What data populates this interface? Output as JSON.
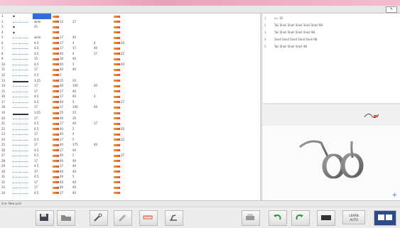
{
  "topbar": {
    "corner_button_label": "✎"
  },
  "program": {
    "rows": [
      {
        "idx": "1",
        "icon": "feed-icon",
        "c1": "",
        "c2": "",
        "c3": "",
        "c4": "",
        "c5": "",
        "c6": "",
        "selected": true
      },
      {
        "idx": "2",
        "icon": "wave-small",
        "c1": "wide",
        "c2": "12",
        "c3": "17",
        "c4": "",
        "c5": "",
        "c6": ""
      },
      {
        "idx": "3",
        "icon": "tool-icon",
        "c1": "45",
        "c2": "",
        "c3": "",
        "c4": "",
        "c5": "",
        "c6": ""
      },
      {
        "idx": "4",
        "icon": "start-icon",
        "c1": "",
        "c2": "",
        "c3": "",
        "c4": "",
        "c5": "",
        "c6": ""
      },
      {
        "idx": "5",
        "icon": "wave-small",
        "c1": "wide",
        "c2": "17",
        "c3": "40",
        "c4": "",
        "c5": "",
        "c6": ""
      },
      {
        "idx": "6",
        "icon": "wave-small",
        "c1": "4.5",
        "c2": "17",
        "c3": "4",
        "c4": "4",
        "c5": "20",
        "c6": ""
      },
      {
        "idx": "7",
        "icon": "wave-small",
        "c1": "4.5",
        "c2": "17",
        "c3": "17",
        "c4": "40",
        "c5": "",
        "c6": ""
      },
      {
        "idx": "8",
        "icon": "wave-small",
        "c1": "4.5",
        "c2": "40",
        "c3": "4",
        "c4": "17",
        "c5": "22",
        "c6": ""
      },
      {
        "idx": "9",
        "icon": "wave-small",
        "c1": "15",
        "c2": "30",
        "c3": "40",
        "c4": "",
        "c5": "",
        "c6": ""
      },
      {
        "idx": "10",
        "icon": "wave-small",
        "c1": "4.5",
        "c2": "40",
        "c3": "5",
        "c4": "",
        "c5": "40",
        "c6": ""
      },
      {
        "idx": "11",
        "icon": "wave-small",
        "c1": "17",
        "c2": "40",
        "c3": "40",
        "c4": "",
        "c5": "",
        "c6": ""
      },
      {
        "idx": "12",
        "icon": "wave-small",
        "c1": "4.5",
        "c2": "5",
        "c3": "",
        "c4": "",
        "c5": "",
        "c6": ""
      },
      {
        "idx": "13",
        "icon": "wave-big",
        "c1": "3.25",
        "c2": "35",
        "c3": "25",
        "c4": "",
        "c5": "",
        "c6": ""
      },
      {
        "idx": "14",
        "icon": "wave-small",
        "c1": "17",
        "c2": "40",
        "c3": "100",
        "c4": "40",
        "c5": "",
        "c6": ""
      },
      {
        "idx": "15",
        "icon": "wave-small",
        "c1": "17",
        "c2": "17",
        "c3": "40",
        "c4": "",
        "c5": "",
        "c6": ""
      },
      {
        "idx": "16",
        "icon": "wave-small",
        "c1": "4.5",
        "c2": "17",
        "c3": "40",
        "c4": "4",
        "c5": "",
        "c6": ""
      },
      {
        "idx": "17",
        "icon": "wave-small",
        "c1": "4.5",
        "c2": "40",
        "c3": "5",
        "c4": "",
        "c5": "17",
        "c6": ""
      },
      {
        "idx": "18",
        "icon": "wave-small",
        "c1": "17",
        "c2": "17",
        "c3": "100",
        "c4": "40",
        "c5": "",
        "c6": ""
      },
      {
        "idx": "19",
        "icon": "wave-big",
        "c1": "3.25",
        "c2": "35",
        "c3": "25",
        "c4": "",
        "c5": "",
        "c6": ""
      },
      {
        "idx": "20",
        "icon": "wave-small",
        "c1": "17",
        "c2": "40",
        "c3": "30",
        "c4": "",
        "c5": "",
        "c6": ""
      },
      {
        "idx": "21",
        "icon": "wave-small",
        "c1": "4.5",
        "c2": "17",
        "c3": "40",
        "c4": "17",
        "c5": "",
        "c6": ""
      },
      {
        "idx": "22",
        "icon": "wave-small",
        "c1": "4.5",
        "c2": "40",
        "c3": "5",
        "c4": "",
        "c5": "20",
        "c6": ""
      },
      {
        "idx": "23",
        "icon": "wave-small",
        "c1": "17",
        "c2": "40",
        "c3": "4",
        "c4": "",
        "c5": "",
        "c6": ""
      },
      {
        "idx": "24",
        "icon": "wave-small",
        "c1": "4.5",
        "c2": "17",
        "c3": "5",
        "c4": "",
        "c5": "22",
        "c6": ""
      },
      {
        "idx": "25",
        "icon": "wave-small",
        "c1": "17",
        "c2": "40",
        "c3": "175",
        "c4": "40",
        "c5": "",
        "c6": ""
      },
      {
        "idx": "26",
        "icon": "wave-small",
        "c1": "4.5",
        "c2": "17",
        "c3": "40",
        "c4": "",
        "c5": "",
        "c6": ""
      },
      {
        "idx": "27",
        "icon": "wave-small",
        "c1": "4.5",
        "c2": "40",
        "c3": "5",
        "c4": "",
        "c5": "17",
        "c6": ""
      },
      {
        "idx": "28",
        "icon": "wave-small",
        "c1": "17",
        "c2": "40",
        "c3": "40",
        "c4": "",
        "c5": "",
        "c6": ""
      },
      {
        "idx": "29",
        "icon": "wave-small",
        "c1": "4.5",
        "c2": "17",
        "c3": "40",
        "c4": "",
        "c5": "",
        "c6": ""
      },
      {
        "idx": "30",
        "icon": "wave-small",
        "c1": "17",
        "c2": "40",
        "c3": "40",
        "c4": "",
        "c5": "",
        "c6": ""
      },
      {
        "idx": "31",
        "icon": "wave-small",
        "c1": "4.5",
        "c2": "40",
        "c3": "5",
        "c4": "",
        "c5": "",
        "c6": ""
      },
      {
        "idx": "32",
        "icon": "wave-small",
        "c1": "17",
        "c2": "40",
        "c3": "40",
        "c4": "",
        "c5": "",
        "c6": ""
      },
      {
        "idx": "33",
        "icon": "wave-small",
        "c1": "17",
        "c2": "40",
        "c3": "40",
        "c4": "",
        "c5": "",
        "c6": ""
      },
      {
        "idx": "34",
        "icon": "wave-small",
        "c1": "4.5",
        "c2": "17",
        "c3": "40",
        "c4": "",
        "c5": "",
        "c6": ""
      }
    ]
  },
  "right_panel": {
    "lines": [
      {
        "n": "1",
        "text": "x= 16"
      },
      {
        "n": "2",
        "text": "Tail Shell Shell Shell Shell Shell 9B"
      },
      {
        "n": "3",
        "text": "Tail Shell Shell Shell Shell 9B"
      },
      {
        "n": "4",
        "text": "Shell Shell Shell Shell Shell 9B"
      },
      {
        "n": "5",
        "text": "Tail Shell Shell Shell 9B"
      }
    ]
  },
  "statusbar": {
    "text": "line: New part"
  },
  "toolbar": {
    "text_button_1": "LEARN",
    "text_button_2": "AUTO"
  },
  "colors": {
    "accent": "#2f6ed4",
    "selection": "#2f6ed4"
  }
}
